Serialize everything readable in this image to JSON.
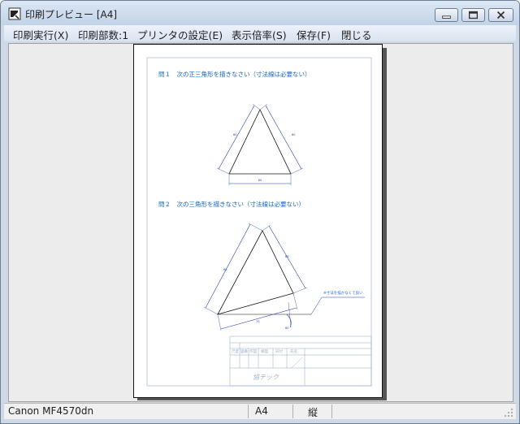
{
  "window": {
    "title": "印刷プレビュー [A4]"
  },
  "menu": {
    "items": [
      {
        "label": "印刷実行(X)"
      },
      {
        "label": "印刷部数:1"
      },
      {
        "label": "プリンタの設定(E)"
      },
      {
        "label": "表示倍率(S)"
      },
      {
        "label": "保存(F)"
      },
      {
        "label": "閉じる"
      }
    ]
  },
  "sheet": {
    "q1": "問１　次の正三角形を描きなさい（寸法線は必要ない）",
    "q2": "問２　次の三角形を描きなさい（寸法線は必要ない）",
    "note": "※寸法を描かなくて良い",
    "title_block": {
      "logo": "協テック",
      "cells": [
        "尺度",
        "図番",
        "作図",
        "検図",
        "日付",
        "氏名"
      ]
    }
  },
  "status": {
    "printer": "Canon MF4570dn",
    "paper": "A4",
    "orientation": "縦"
  },
  "colors": {
    "drawing_blue": "#1f3fb0",
    "frame_blue": "#8fa8c8",
    "text_blue": "#1868c8"
  }
}
